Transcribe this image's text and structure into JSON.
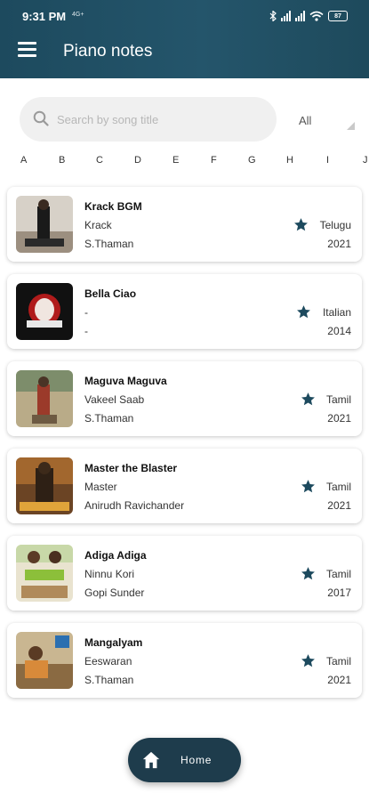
{
  "status_bar": {
    "time": "9:31 PM",
    "extra": "4G+",
    "battery": "87"
  },
  "app_bar": {
    "title": "Piano notes",
    "menu_icon": "hamburger-menu-icon"
  },
  "search": {
    "placeholder": "Search by song title",
    "icon": "search-icon"
  },
  "language_filter": {
    "selected": "All"
  },
  "alphabet": [
    "A",
    "B",
    "C",
    "D",
    "E",
    "F",
    "G",
    "H",
    "I",
    "J"
  ],
  "songs": [
    {
      "title": "Krack BGM",
      "movie": "Krack",
      "composer": "S.Thaman",
      "language": "Telugu",
      "year": "2021"
    },
    {
      "title": "Bella Ciao",
      "movie": "-",
      "composer": "-",
      "language": "Italian",
      "year": "2014"
    },
    {
      "title": "Maguva Maguva",
      "movie": "Vakeel Saab",
      "composer": "S.Thaman",
      "language": "Tamil",
      "year": "2021"
    },
    {
      "title": "Master the Blaster",
      "movie": "Master",
      "composer": "Anirudh Ravichander",
      "language": "Tamil",
      "year": "2021"
    },
    {
      "title": "Adiga Adiga",
      "movie": "Ninnu Kori",
      "composer": "Gopi Sunder",
      "language": "Tamil",
      "year": "2017"
    },
    {
      "title": "Mangalyam",
      "movie": "Eeswaran",
      "composer": "S.Thaman",
      "language": "Tamil",
      "year": "2021"
    }
  ],
  "bottom_nav": {
    "home_label": "Home",
    "home_icon": "home-icon"
  },
  "colors": {
    "app_bar": "#1d4a5e",
    "accent": "#1e3c4c",
    "star": "#1d4a5e"
  }
}
